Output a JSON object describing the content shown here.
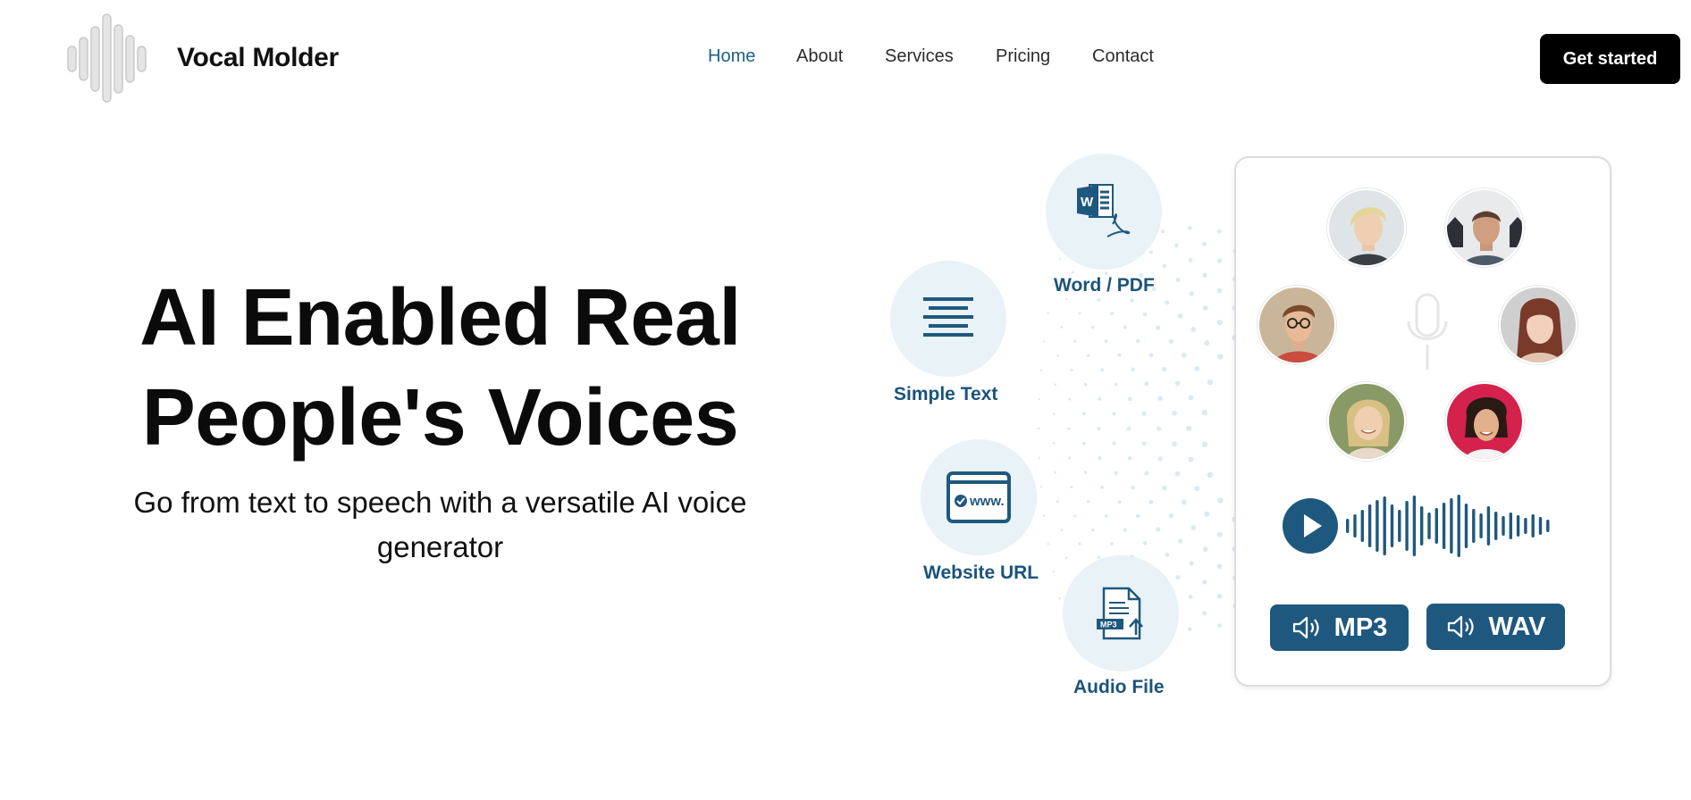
{
  "brand": {
    "name": "Vocal Molder",
    "logo_icon": "sound-wave-logo"
  },
  "nav": {
    "items": [
      {
        "label": "Home",
        "active": true
      },
      {
        "label": "About",
        "active": false
      },
      {
        "label": "Services",
        "active": false
      },
      {
        "label": "Pricing",
        "active": false
      },
      {
        "label": "Contact",
        "active": false
      }
    ],
    "cta_label": "Get started"
  },
  "hero": {
    "title_line1": "AI Enabled Real",
    "title_line2": "People's Voices",
    "subtitle_line1": "Go from text to speech with a versatile AI voice",
    "subtitle_line2": "generator"
  },
  "inputs": {
    "word_pdf": {
      "label": "Word / PDF",
      "icon": "word-pdf-icon"
    },
    "simple_text": {
      "label": "Simple Text",
      "icon": "text-lines-icon"
    },
    "website_url": {
      "label": "Website URL",
      "icon": "browser-www-icon"
    },
    "audio_file": {
      "label": "Audio File",
      "icon": "mp3-file-upload-icon"
    }
  },
  "card": {
    "voices_count": 6,
    "file_icon_text": "MP3",
    "url_icon_text": "www.",
    "formats": [
      {
        "label": "MP3",
        "icon": "speaker-icon"
      },
      {
        "label": "WAV",
        "icon": "speaker-icon"
      }
    ]
  },
  "colors": {
    "accent": "#1f587e",
    "nav_active": "#1e5f86",
    "bubble_bg": "#e8f2f7",
    "label": "#1b5479",
    "cta_bg": "#000000"
  }
}
